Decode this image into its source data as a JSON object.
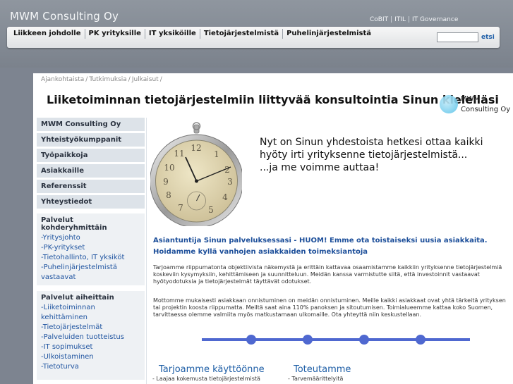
{
  "header": {
    "brand": "MWM Consulting Oy",
    "top_links": [
      "CoBIT",
      "ITIL",
      "IT Governance"
    ],
    "top_links_separator": "|"
  },
  "nav": {
    "items": [
      "Liikkeen johdolle",
      "PK yrityksille",
      "IT yksiköille",
      "Tietojärjestelmistä",
      "Puhelinjärjestelmistä"
    ],
    "search_button": "etsi",
    "search_value": ""
  },
  "breadcrumb": [
    "Ajankohtaista",
    "Tutkimuksia",
    "Julkaisut"
  ],
  "breadcrumb_separator": "/",
  "headline": "Liiketoiminnan tietojärjestelmiin liittyvää konsultointia Sinun kielelläsi",
  "logo": {
    "line1": "MWM",
    "line2": "Consulting Oy"
  },
  "sidebar": {
    "items": [
      "MWM Consulting Oy",
      "Yhteistyökumppanit",
      "Työpaikkoja",
      "Asiakkaille",
      "Referenssit",
      "Yhteystiedot"
    ],
    "group1": {
      "title": "Palvelut kohderyhmittäin",
      "links": [
        "-Yritysjohto",
        "-PK-yritykset",
        "-Tietohallinto, IT yksiköt",
        "-Puhelinjärjestelmistä vastaavat"
      ]
    },
    "group2": {
      "title": "Palvelut aiheittain",
      "links": [
        "-Liiketoiminnan kehittäminen",
        "-Tietojärjestelmät",
        "-Palveluiden tuotteistus",
        "-IT sopimukset",
        "-Ulkoistaminen",
        "-Tietoturva"
      ]
    }
  },
  "content": {
    "intro": [
      "Nyt on Sinun yhdestoista hetkesi ottaa kaikki",
      "hyöty irti yrityksenne tietojärjestelmistä...",
      "...ja me voimme auttaa!"
    ],
    "highlight": "Asiantuntija Sinun palveluksessasi - HUOM! Emme ota toistaiseksi uusia asiakkaita. Hoidamme kyllä vanhojen asiakkaiden toimeksiantoja",
    "body1": "Tarjoamme riippumatonta objektiivista näkemystä ja erittäin kattavaa osaamistamme kaikkiin yrityksenne tietojärjestelmiä koskeviin kysymyksiin, kehittämiseen ja suunnitteluun. Meidän kanssa varmistutte siitä, että investoinnit vastaavat hyötyodotuksia ja tietojärjestelmät täyttävät odotukset.",
    "body2": "Mottomme mukaisesti asiakkaan onnistuminen on meidän onnistuminen. Meille kaikki asiakkaat ovat yhtä tärkeitä yrityksen tai projektin koosta riippumatta. Meiltä saat aina 110% panoksen ja sitoutumisen. Toimialueemme kattaa koko Suomen, tarvittaessa olemme valmiita myös matkustamaan ulkomaille. Ota yhteyttä niin keskustellaan.",
    "section1": {
      "title": "Tarjoamme käyttöönne",
      "sub": "- Laajaa kokemusta tietojärjestelmistä"
    },
    "section2": {
      "title": "Toteutamme",
      "sub": "- Tarvemäärittelyitä"
    }
  },
  "colors": {
    "accent": "#1e5ea6",
    "nav_bg": "#e6e8eb",
    "sidebar_bg": "#dde3e9",
    "page_bg": "#7d8490"
  }
}
